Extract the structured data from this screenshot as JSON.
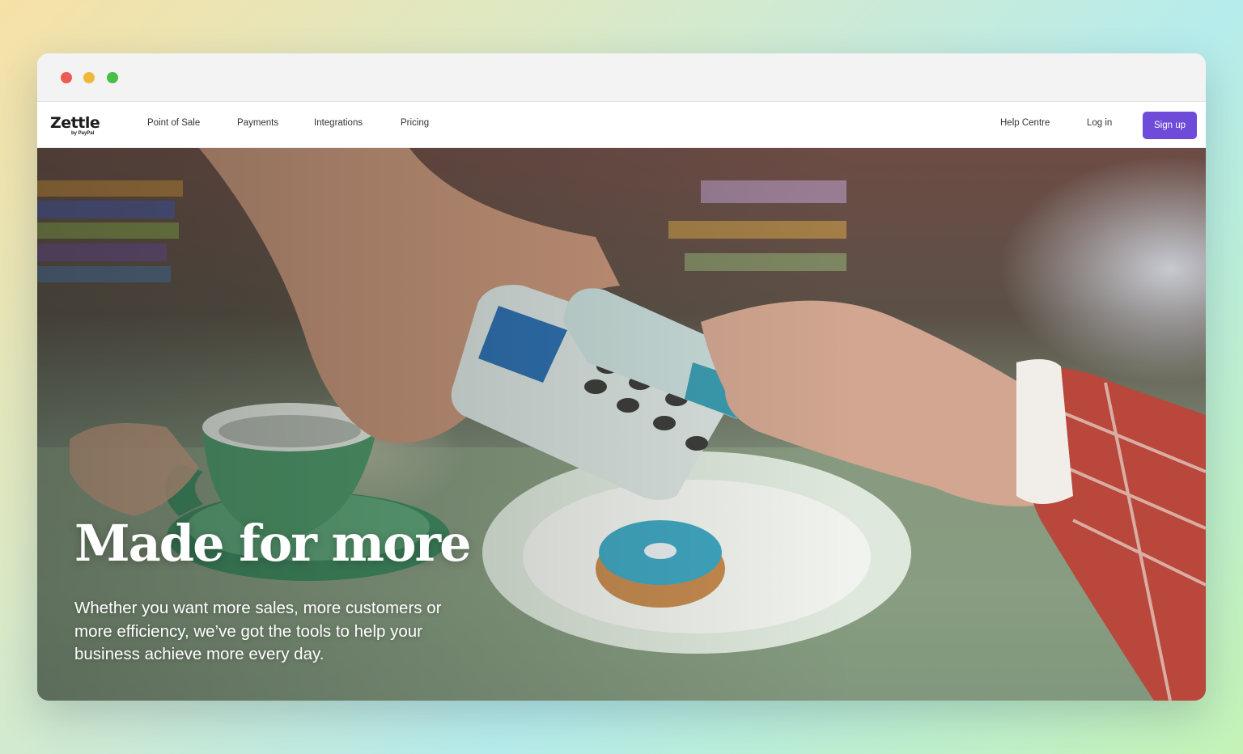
{
  "window": {
    "controls": [
      "close-dot",
      "minimize-dot",
      "maximize-dot"
    ]
  },
  "navbar": {
    "logo": {
      "name": "Zettle",
      "tagline": "by PayPal"
    },
    "links": [
      {
        "label": "Point of Sale"
      },
      {
        "label": "Payments"
      },
      {
        "label": "Integrations"
      },
      {
        "label": "Pricing"
      }
    ],
    "right_links": [
      {
        "label": "Help Centre"
      },
      {
        "label": "Log in"
      }
    ],
    "cta_label": "Sign up"
  },
  "hero": {
    "title": "Made for more",
    "body": "Whether you want more sales, more customers or more efficiency, we’ve got the tools to help your business achieve more every day."
  },
  "colors": {
    "accent": "#6e4bd8",
    "close": "#ec5a53",
    "minimize": "#eeb93a",
    "maximize": "#49bf4a"
  }
}
